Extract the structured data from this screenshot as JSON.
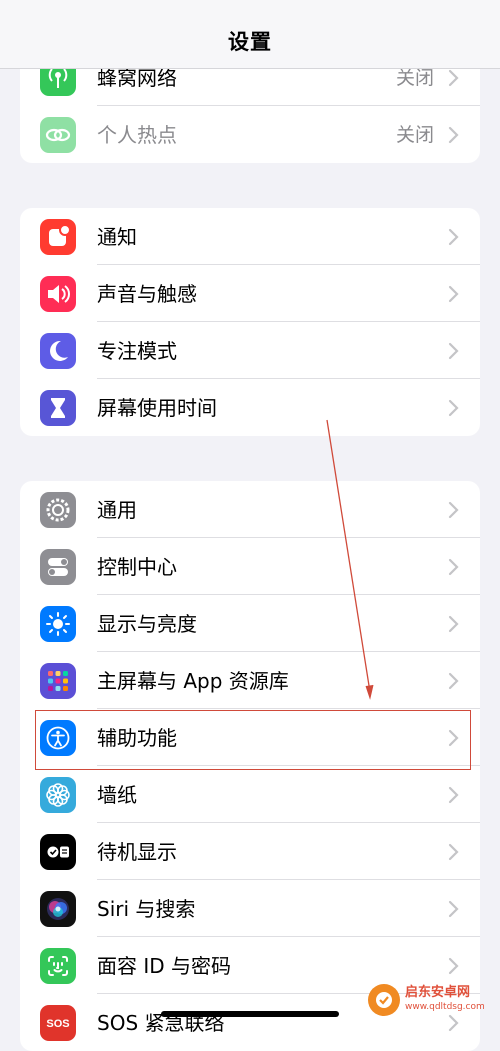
{
  "header": {
    "title": "设置"
  },
  "groups": [
    {
      "rows": [
        {
          "label": "蜂窝网络",
          "value": "关闭",
          "icon": "cellular-icon"
        },
        {
          "label": "个人热点",
          "value": "关闭",
          "icon": "hotspot-icon"
        }
      ]
    },
    {
      "rows": [
        {
          "label": "通知",
          "icon": "notifications-icon"
        },
        {
          "label": "声音与触感",
          "icon": "sound-icon"
        },
        {
          "label": "专注模式",
          "icon": "moon-icon"
        },
        {
          "label": "屏幕使用时间",
          "icon": "hourglass-icon"
        }
      ]
    },
    {
      "rows": [
        {
          "label": "通用",
          "icon": "gear-icon"
        },
        {
          "label": "控制中心",
          "icon": "toggles-icon"
        },
        {
          "label": "显示与亮度",
          "icon": "sun-icon"
        },
        {
          "label": "主屏幕与 App 资源库",
          "icon": "app-grid-icon"
        },
        {
          "label": "辅助功能",
          "icon": "accessibility-icon"
        },
        {
          "label": "墙纸",
          "icon": "flower-icon"
        },
        {
          "label": "待机显示",
          "icon": "standby-icon"
        },
        {
          "label": "Siri 与搜索",
          "icon": "siri-icon"
        },
        {
          "label": "面容 ID 与密码",
          "icon": "face-id-icon"
        },
        {
          "label": "SOS 紧急联络",
          "icon": "sos-icon"
        }
      ]
    }
  ],
  "annotation": {
    "highlighted_row": "辅助功能"
  },
  "watermark": {
    "name": "启东安卓网",
    "url": "www.qdltdsg.com"
  },
  "colors": {
    "background": "#f2f2f7",
    "cellular": "#34c759",
    "notifications": "#ff3b30",
    "sound": "#ff2d55",
    "focus": "#5e5ce6",
    "screen_time": "#5856d6",
    "general": "#8e8e93",
    "display": "#007aff",
    "accessibility": "#007aff",
    "wallpaper": "#35aadc",
    "face_id": "#34c759",
    "sos": "#e0342b",
    "annotation": "#d04a3a"
  }
}
